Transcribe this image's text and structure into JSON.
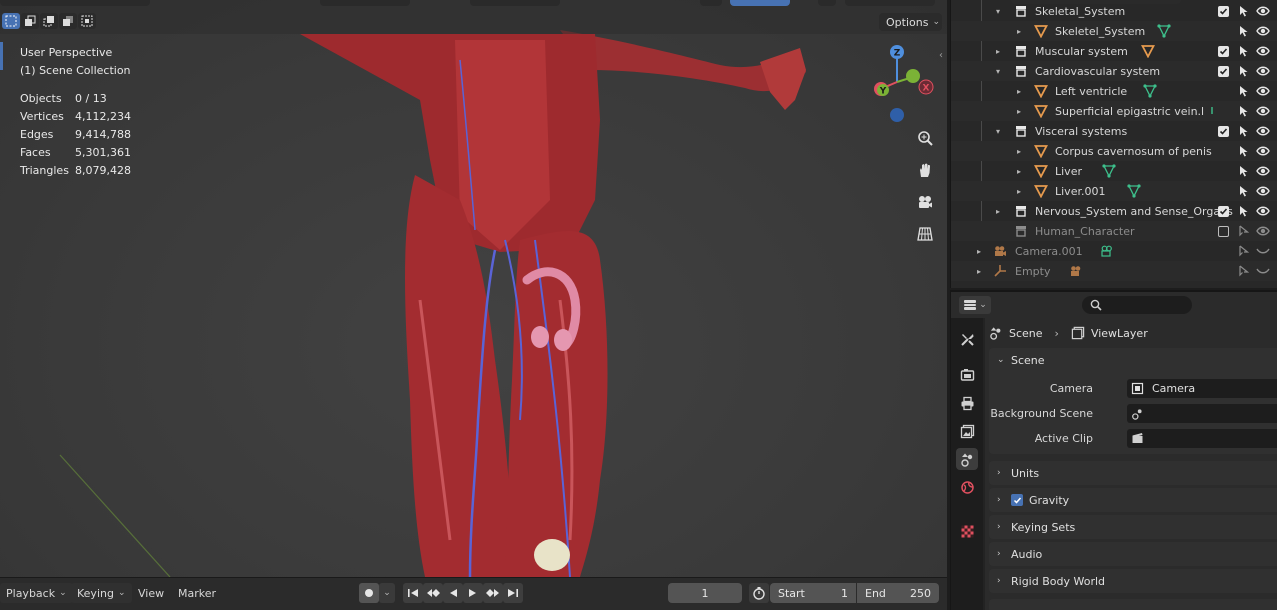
{
  "viewport": {
    "view_name": "User Perspective",
    "collection_name": "(1) Scene Collection",
    "stats": [
      {
        "label": "Objects",
        "value": "0 / 13"
      },
      {
        "label": "Vertices",
        "value": "4,112,234"
      },
      {
        "label": "Edges",
        "value": "9,414,788"
      },
      {
        "label": "Faces",
        "value": "5,301,361"
      },
      {
        "label": "Triangles",
        "value": "8,079,428"
      }
    ],
    "options_label": "Options",
    "gizmo": {
      "z": "Z",
      "y": "Y",
      "x": "X"
    }
  },
  "timeline": {
    "playback_label": "Playback",
    "keying_label": "Keying",
    "view_label": "View",
    "marker_label": "Marker",
    "current_frame": "1",
    "start_label": "Start",
    "start_value": "1",
    "end_label": "End",
    "end_value": "250"
  },
  "outliner": {
    "rows": [
      {
        "label": "Skeletal_System",
        "kind": "collection"
      },
      {
        "label": "Skeletel_System",
        "kind": "object"
      },
      {
        "label": "Muscular system",
        "kind": "collection"
      },
      {
        "label": "Cardiovascular system",
        "kind": "collection"
      },
      {
        "label": "Left ventricle",
        "kind": "object"
      },
      {
        "label": "Superficial epigastric vein.l",
        "kind": "object"
      },
      {
        "label": "Visceral systems",
        "kind": "collection"
      },
      {
        "label": "Corpus cavernosum of penis",
        "kind": "object"
      },
      {
        "label": "Liver",
        "kind": "object"
      },
      {
        "label": "Liver.001",
        "kind": "object"
      },
      {
        "label": "Nervous_System and Sense_Organs",
        "kind": "collection"
      },
      {
        "label": "Human_Character",
        "kind": "collection-disabled"
      },
      {
        "label": "Camera.001",
        "kind": "camera"
      },
      {
        "label": "Empty",
        "kind": "empty"
      }
    ]
  },
  "properties": {
    "breadcrumb_scene": "Scene",
    "breadcrumb_viewlayer": "ViewLayer",
    "scene_panel": {
      "title": "Scene",
      "camera_label": "Camera",
      "camera_value": "Camera",
      "background_scene_label": "Background Scene",
      "active_clip_label": "Active Clip"
    },
    "collapsed_panels": [
      "Units",
      "Gravity",
      "Keying Sets",
      "Audio",
      "Rigid Body World"
    ]
  },
  "colors": {
    "accent": "#4772b3",
    "collection_orange": "#e69a4e",
    "mesh_green": "#3dc08c",
    "axis_x": "#e0505f",
    "axis_y": "#7bb236",
    "axis_z": "#4f8fde"
  }
}
